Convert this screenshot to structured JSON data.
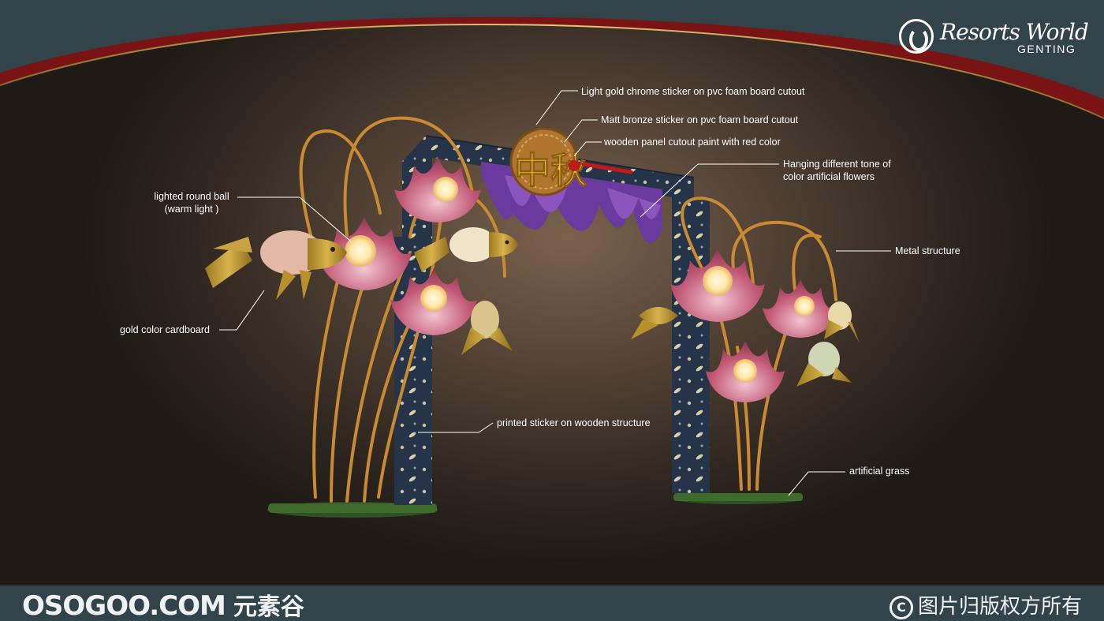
{
  "brand": {
    "script": "Resorts World",
    "sub": "GENTING"
  },
  "callouts": {
    "light_gold": "Light gold chrome sticker on pvc foam board cutout",
    "matt_bronze": "Matt bronze sticker on pvc foam board cutout",
    "wooden_panel": "wooden panel cutout paint with red color",
    "hanging_line1": "Hanging different tone of",
    "hanging_line2": "color artificial flowers",
    "ball_line1": "lighted round ball",
    "ball_line2": "(warm light )",
    "metal": "Metal structure",
    "gold_cardboard": "gold color cardboard",
    "printed_sticker": "printed sticker on wooden structure",
    "grass": "artificial grass"
  },
  "sign": {
    "chars": "中秋"
  },
  "watermark": {
    "site": "OSOGOO.COM",
    "site_cn": "元素谷",
    "rights": "图片归版权方所有",
    "copyright_symbol": "C"
  },
  "colors": {
    "header_teal": "#33434a",
    "header_red": "#7a1414",
    "arch_navy": "#253449",
    "petal_pink": "#b8546e",
    "gold": "#d9a441",
    "grass": "#3f6b2c",
    "wisteria": "#6b3a9e"
  }
}
